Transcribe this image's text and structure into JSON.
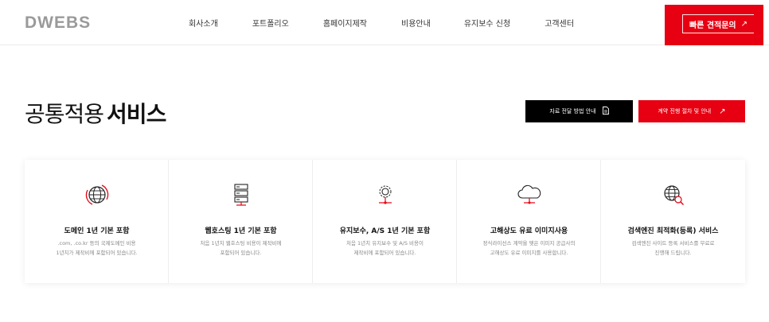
{
  "header": {
    "logo": "DWEBS",
    "nav": [
      "회사소개",
      "포트폴리오",
      "홈페이지제작",
      "비용안내",
      "유지보수 신청",
      "고객센터"
    ],
    "quote_label": "빠른 견적문의",
    "quote_arrow": "↗"
  },
  "section": {
    "title_light": "공통적용",
    "title_bold": "서비스",
    "btn_guide": "자료 전달 방법 안내",
    "btn_contract": "계약 진행 절차 및 안내",
    "btn_contract_arrow": "↗"
  },
  "cards": [
    {
      "icon": "globe-icon",
      "title": "도메인 1년 기본 포함",
      "desc": [
        ".com, .co.kr 등의 국제도메인 비용",
        "1년치가 제작비에 포함되어 있습니다."
      ]
    },
    {
      "icon": "server-icon",
      "title": "웹호스팅 1년 기본 포함",
      "desc": [
        "처음 1년치 웹호스팅 비용이 제작비에",
        "포함되어 있습니다."
      ]
    },
    {
      "icon": "maintenance-gear-icon",
      "title": "유지보수, A/S 1년 기본 포함",
      "desc": [
        "처음 1년치 유지보수 및 A/S 비용이",
        "제작비에 포함되어 있습니다."
      ]
    },
    {
      "icon": "cloud-icon",
      "title": "고해상도 유료 이미지사용",
      "desc": [
        "정식라이선스 계약을 맺은 이미지 공급사의",
        "고해상도 유료 이미지를 사용합니다."
      ]
    },
    {
      "icon": "globe-search-icon",
      "title": "검색엔진 최적화(등록) 서비스",
      "desc": [
        "검색엔진 사이트 등록 서비스를 무료로",
        "진행해 드립니다."
      ]
    }
  ],
  "colors": {
    "accent": "#e60012",
    "dark": "#000000"
  }
}
